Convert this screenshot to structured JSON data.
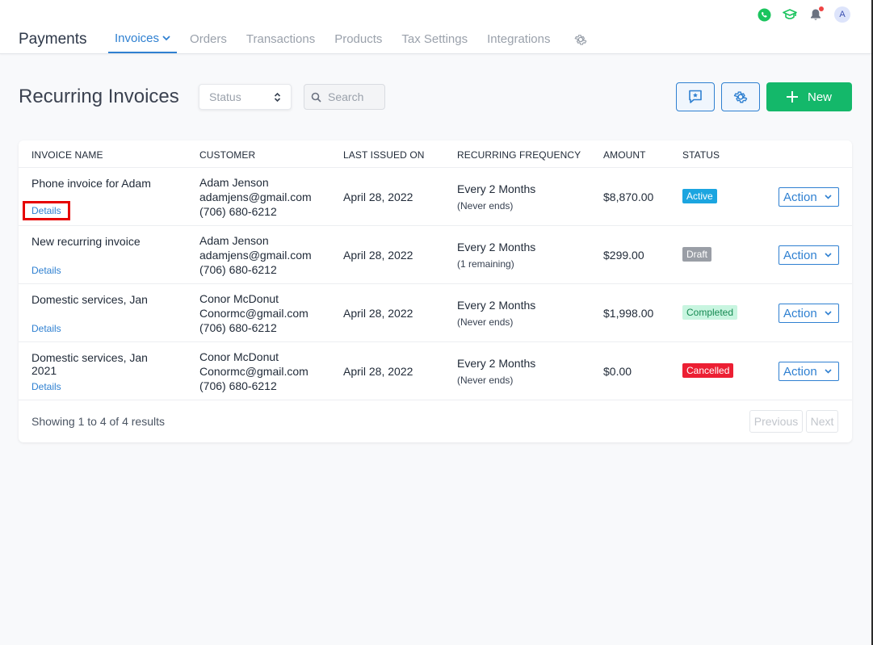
{
  "app": {
    "title": "Payments"
  },
  "header_icons": [
    {
      "name": "whatsapp-icon",
      "color": "#1bc45e"
    },
    {
      "name": "graduation-cap-icon",
      "color": "#1bc45e"
    },
    {
      "name": "bell-icon",
      "color": "#6b7280"
    },
    {
      "name": "avatar",
      "label": "A"
    }
  ],
  "nav": {
    "items": [
      {
        "label": "Invoices",
        "active": true
      },
      {
        "label": "Orders"
      },
      {
        "label": "Transactions"
      },
      {
        "label": "Products"
      },
      {
        "label": "Tax Settings"
      },
      {
        "label": "Integrations"
      }
    ],
    "settings_icon": "gear-icon"
  },
  "page": {
    "title": "Recurring Invoices",
    "status_filter": {
      "value": "Status"
    },
    "search": {
      "placeholder": "Search"
    },
    "new_button": "New"
  },
  "table": {
    "columns": [
      "INVOICE NAME",
      "CUSTOMER",
      "LAST ISSUED ON",
      "RECURRING FREQUENCY",
      "AMOUNT",
      "STATUS"
    ],
    "rows": [
      {
        "name": "Phone invoice for Adam",
        "details": "Details",
        "customer_name": "Adam Jenson",
        "customer_email": "adamjens@gmail.com",
        "customer_phone": "(706) 680-6212",
        "last_issued": "April 28, 2022",
        "frequency": "Every 2 Months",
        "frequency_note": "(Never ends)",
        "amount": "$8,870.00",
        "status": "Active",
        "action": "Action"
      },
      {
        "name": "New recurring invoice",
        "details": "Details",
        "customer_name": "Adam Jenson",
        "customer_email": "adamjens@gmail.com",
        "customer_phone": "(706) 680-6212",
        "last_issued": "April 28, 2022",
        "frequency": "Every 2 Months",
        "frequency_note": "(1 remaining)",
        "amount": "$299.00",
        "status": "Draft",
        "action": "Action"
      },
      {
        "name": "Domestic services, Jan",
        "details": "Details",
        "customer_name": "Conor McDonut",
        "customer_email": "Conormc@gmail.com",
        "customer_phone": "(706) 680-6212",
        "last_issued": "April 28, 2022",
        "frequency": "Every 2 Months",
        "frequency_note": "(Never ends)",
        "amount": "$1,998.00",
        "status": "Completed",
        "action": "Action"
      },
      {
        "name": "Domestic services, Jan 2021",
        "details": "Details",
        "customer_name": "Conor McDonut",
        "customer_email": "Conormc@gmail.com",
        "customer_phone": "(706) 680-6212",
        "last_issued": "April 28, 2022",
        "frequency": "Every 2 Months",
        "frequency_note": "(Never ends)",
        "amount": "$0.00",
        "status": "Cancelled",
        "action": "Action"
      }
    ]
  },
  "pagination": {
    "summary": "Showing 1 to 4 of 4 results",
    "previous": "Previous",
    "next": "Next"
  }
}
